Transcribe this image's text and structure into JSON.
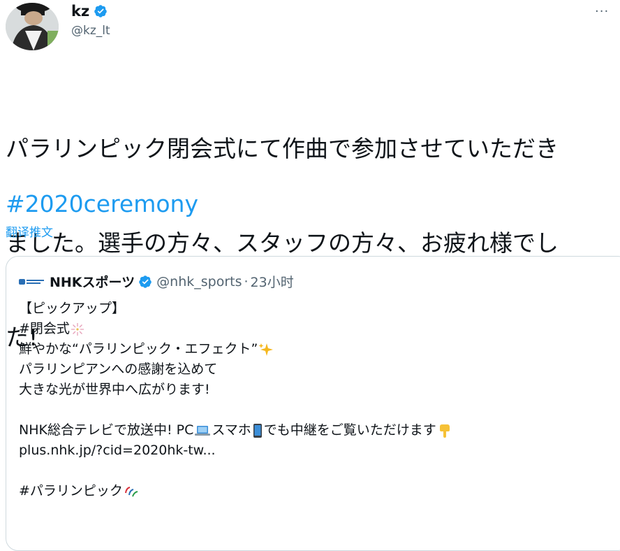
{
  "tweet": {
    "author": {
      "display_name": "kz",
      "handle": "@kz_lt",
      "verified": true
    },
    "more_label": "···",
    "text": "パラリンピック閉会式にて作曲で参加させていただきました。選手の方々、スタッフの方々、お疲れ様でした!",
    "text_lines": [
      "パラリンピック閉会式にて作曲で参加させていただき",
      "ました。選手の方々、スタッフの方々、お疲れ様でし",
      "た!"
    ],
    "hashtag": "#2020ceremony",
    "translate_label": "翻译推文"
  },
  "quoted_tweet": {
    "author": {
      "display_name": "NHKスポーツ",
      "handle": "@nhk_sports",
      "separator": "·",
      "time": "23小时",
      "verified": true
    },
    "lines": {
      "l1": "【ピックアップ】",
      "l2": " #閉会式",
      "l3": "鮮やかな“パラリンピック・エフェクト”",
      "l4": "パラリンピアンへの感謝を込めて",
      "l5": "大きな光が世界中へ広がります!",
      "l6a": "NHK総合テレビで放送中!  PC",
      "l6b": "スマホ",
      "l6c": "でも中継をご覧いただけます",
      "l7": "plus.nhk.jp/?cid=2020hk-tw...",
      "l8": "#パラリンピック"
    },
    "icons": {
      "fireworks": "fireworks-icon",
      "sparkles": "sparkles-icon",
      "laptop": "laptop-icon",
      "phone": "mobile-phone-icon",
      "pointing_down": "pointing-down-icon",
      "paralympics": "paralympics-icon"
    }
  },
  "colors": {
    "link": "#1d9bf0",
    "text": "#0f1419",
    "secondary": "#536471",
    "border": "#cfd9de"
  }
}
